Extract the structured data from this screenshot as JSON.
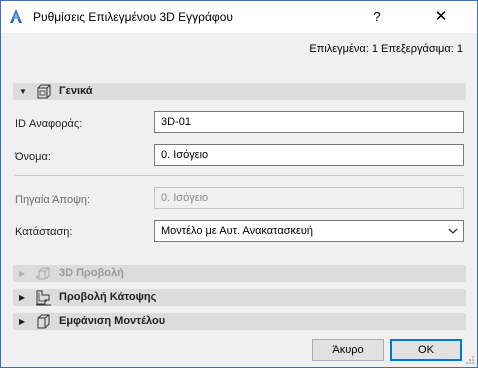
{
  "window": {
    "title": "Ρυθμίσεις Επιλεγμένου 3D Εγγράφου",
    "help_glyph": "?",
    "close_glyph": "✕"
  },
  "status": "Επιλεγμένα: 1 Επεξεργάσιμα: 1",
  "sections": {
    "general": {
      "label": "Γενικά",
      "expanded": true,
      "icon": "document-3d-icon"
    },
    "view3d": {
      "label": "3D Προβολή",
      "expanded": false,
      "disabled": true,
      "icon": "3d-view-icon"
    },
    "floorplan": {
      "label": "Προβολή Κάτοψης",
      "expanded": false,
      "icon": "floor-plan-icon"
    },
    "model": {
      "label": "Εμφάνιση Μοντέλου",
      "expanded": false,
      "icon": "model-cube-icon"
    }
  },
  "fields": {
    "ref_id": {
      "label": "ID Αναφοράς:",
      "value": "3D-01"
    },
    "name": {
      "label": "Όνομα:",
      "value": "0. Ισόγειο"
    },
    "source_view": {
      "label": "Πηγαία Άποψη:",
      "value": "0. Ισόγειο"
    },
    "status": {
      "label": "Κατάσταση:",
      "value": "Μοντέλο με Αυτ. Ανακατασκευή"
    }
  },
  "buttons": {
    "cancel": "Άκυρο",
    "ok": "OK"
  },
  "colors": {
    "accent": "#0078d7",
    "app_icon": "#2a6fc9"
  }
}
